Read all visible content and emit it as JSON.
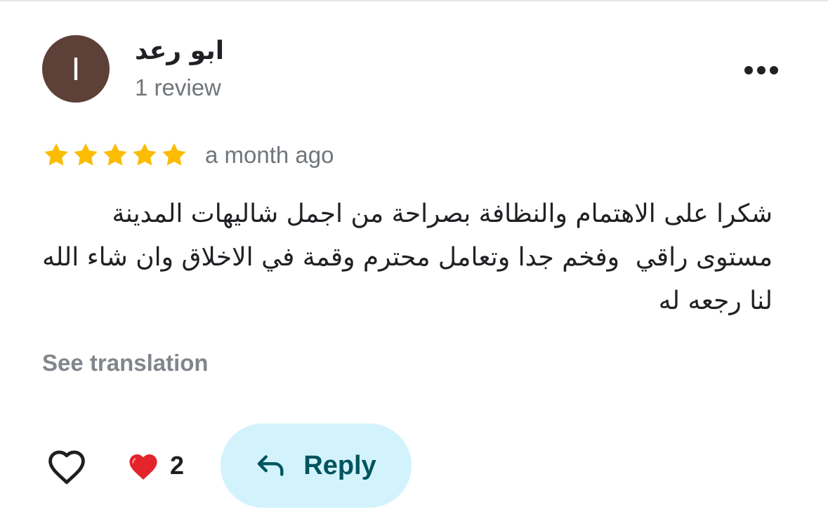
{
  "review": {
    "avatar_initial": "I",
    "avatar_color": "#5d4037",
    "reviewer_name": "ابو رعد",
    "review_count": "1 review",
    "rating": 5,
    "rating_max": 5,
    "star_color": "#fbbc04",
    "date": "a month ago",
    "text": "شكرا على الاهتمام والنظافة بصراحة من اجمل شاليهات المدينة مستوى راقي  وفخم جدا وتعامل محترم وقمة في الاخلاق وان شاء الله لنا رجعه له",
    "see_translation_label": "See translation"
  },
  "actions": {
    "more_icon": "more-horizontal-icon",
    "like_icon": "heart-outline-icon",
    "reaction_icon": "red-heart-emoji",
    "reaction_count": "2",
    "reply_icon": "reply-arrow-icon",
    "reply_label": "Reply",
    "reply_bg_color": "#d3f3fc",
    "reply_text_color": "#00545e"
  }
}
